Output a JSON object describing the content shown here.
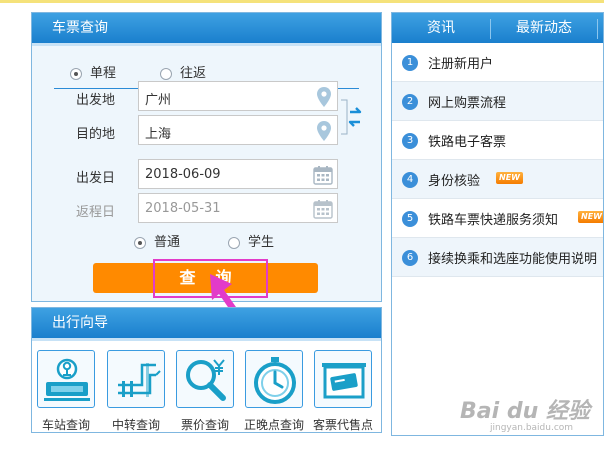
{
  "ticket": {
    "title": "车票查询",
    "trip_oneway": "单程",
    "trip_round": "往返",
    "from_label": "出发地",
    "from_value": "广州",
    "to_label": "目的地",
    "to_value": "上海",
    "depart_label": "出发日",
    "depart_value": "2018-06-09",
    "return_label": "返程日",
    "return_value": "2018-05-31",
    "type_normal": "普通",
    "type_student": "学生",
    "query_label": "查询"
  },
  "guide": {
    "title": "出行向导",
    "items": [
      {
        "label": "车站查询",
        "icon": "train-station-icon"
      },
      {
        "label": "中转查询",
        "icon": "transfer-icon"
      },
      {
        "label": "票价查询",
        "icon": "price-search-icon"
      },
      {
        "label": "正晚点查询",
        "icon": "stopwatch-icon"
      },
      {
        "label": "客票代售点",
        "icon": "ticket-agent-icon"
      }
    ]
  },
  "news": {
    "tabs": [
      "资讯",
      "最新动态"
    ],
    "items": [
      {
        "num": "1",
        "text": "注册新用户",
        "new": false
      },
      {
        "num": "2",
        "text": "网上购票流程",
        "new": false
      },
      {
        "num": "3",
        "text": "铁路电子客票",
        "new": false
      },
      {
        "num": "4",
        "text": "身份核验",
        "new": true
      },
      {
        "num": "5",
        "text": "铁路车票快递服务须知",
        "new": true
      },
      {
        "num": "6",
        "text": "接续换乘和选座功能使用说明",
        "new": false
      }
    ],
    "badge_text": "NEW"
  },
  "watermark": {
    "main": "Bai du 经验",
    "sub": "jingyan.baidu.com"
  },
  "colors": {
    "header_blue": "#1a7fcd",
    "query_orange": "#ff8a00",
    "highlight_magenta": "#e23bc9",
    "number_blue": "#3b8fd9"
  }
}
